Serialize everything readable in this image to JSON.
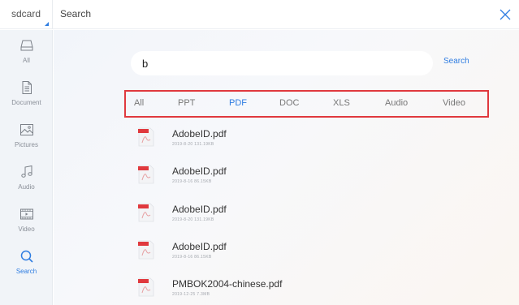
{
  "topbar": {
    "location_label": "sdcard",
    "search_tab_label": "Search"
  },
  "sidebar": {
    "items": [
      {
        "label": "All",
        "icon": "drive-icon"
      },
      {
        "label": "Document",
        "icon": "document-icon"
      },
      {
        "label": "Pictures",
        "icon": "picture-icon"
      },
      {
        "label": "Audio",
        "icon": "music-note-icon"
      },
      {
        "label": "Video",
        "icon": "video-icon"
      },
      {
        "label": "Search",
        "icon": "search-icon",
        "active": true
      }
    ]
  },
  "search": {
    "query": "b",
    "button_label": "Search"
  },
  "filters": [
    "All",
    "PPT",
    "PDF",
    "DOC",
    "XLS",
    "Audio",
    "Video"
  ],
  "active_filter": "PDF",
  "files": [
    {
      "name": "AdobeID.pdf",
      "meta": "2019-8-20   131.19KB"
    },
    {
      "name": "AdobeID.pdf",
      "meta": "2019-8-16   86.15KB"
    },
    {
      "name": "AdobeID.pdf",
      "meta": "2019-8-20   131.19KB"
    },
    {
      "name": "AdobeID.pdf",
      "meta": "2019-8-16   86.15KB"
    },
    {
      "name": "PMBOK2004-chinese.pdf",
      "meta": "2019-12-25   7.3MB"
    }
  ],
  "colors": {
    "accent": "#2f7de1",
    "highlight_border": "#e0393e",
    "pdf_icon": "#e0393e"
  }
}
